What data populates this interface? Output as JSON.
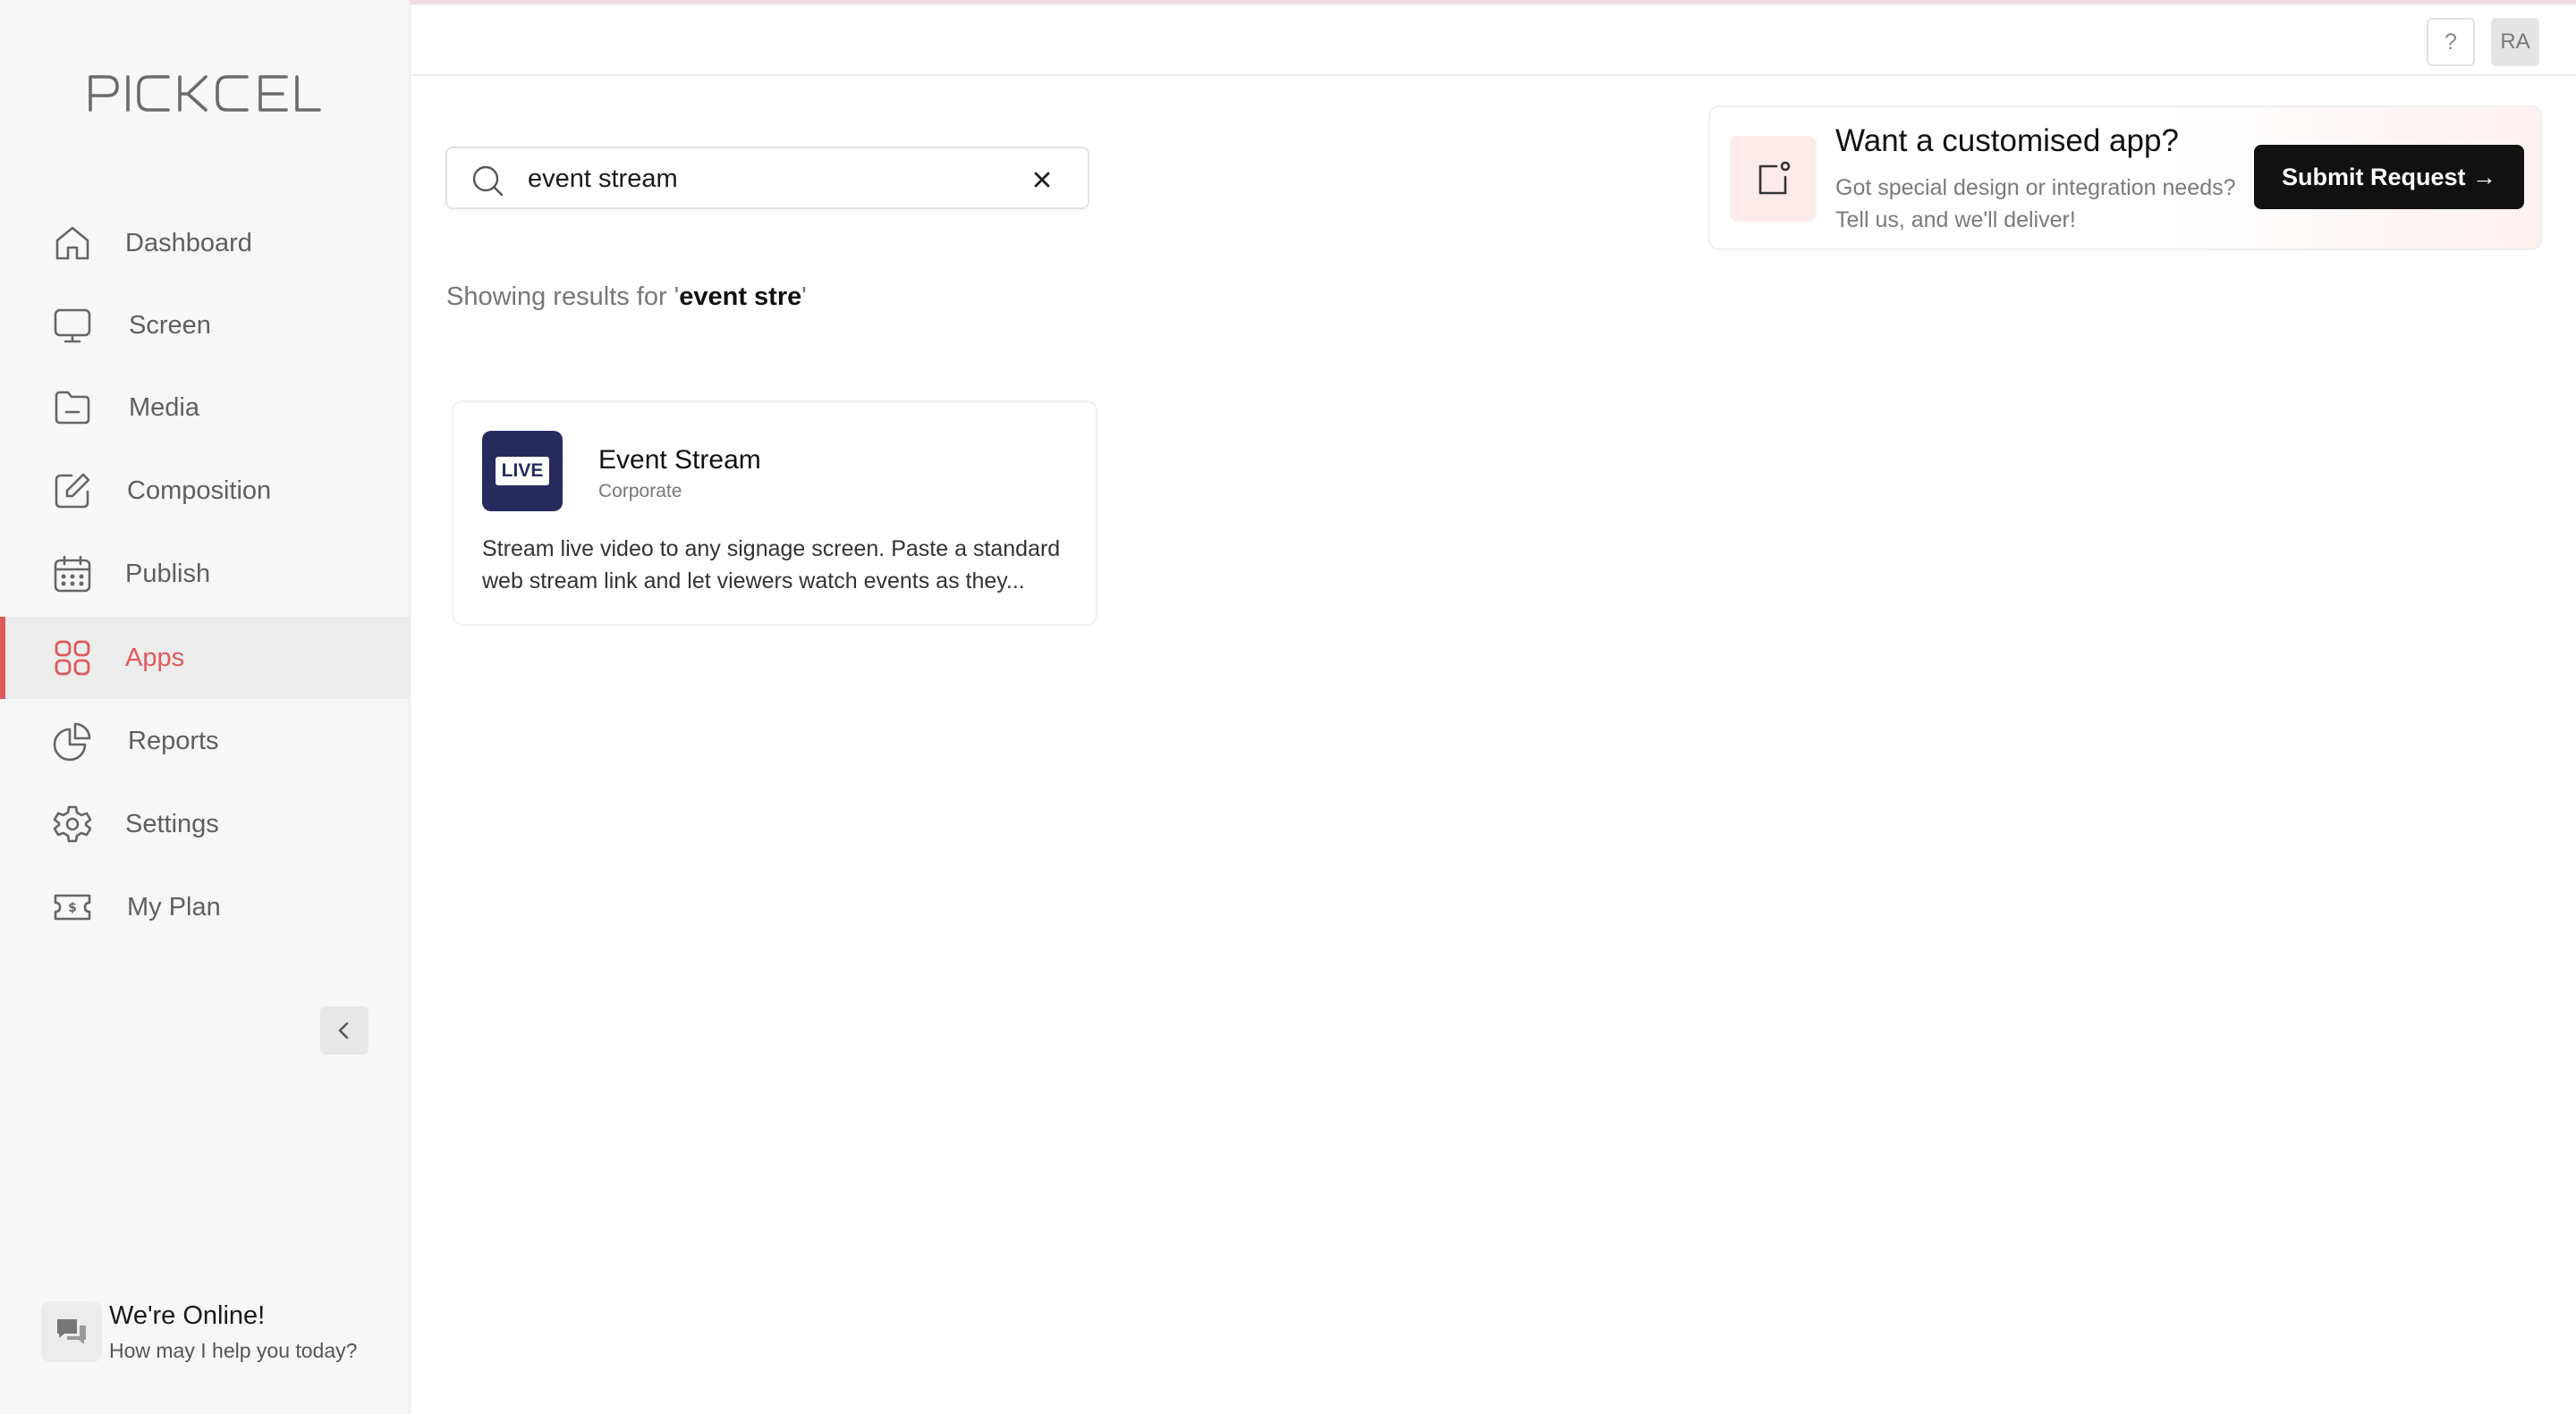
{
  "brand": {
    "logo_text": "PICKCEL"
  },
  "sidebar": {
    "items": [
      {
        "label": "Dashboard",
        "icon": "home-icon"
      },
      {
        "label": "Screen",
        "icon": "monitor-icon"
      },
      {
        "label": "Media",
        "icon": "folder-icon"
      },
      {
        "label": "Composition",
        "icon": "edit-icon"
      },
      {
        "label": "Publish",
        "icon": "calendar-icon"
      },
      {
        "label": "Apps",
        "icon": "grid-icon",
        "active": true
      },
      {
        "label": "Reports",
        "icon": "pie-chart-icon"
      },
      {
        "label": "Settings",
        "icon": "gear-icon"
      },
      {
        "label": "My Plan",
        "icon": "ticket-dollar-icon"
      }
    ],
    "collapse_icon": "chevron-left-icon"
  },
  "chat": {
    "title": "We're Online!",
    "subtitle": "How may I help you today?",
    "icon": "chat-icon"
  },
  "topbar": {
    "help_label": "?",
    "avatar_initials": "RA"
  },
  "search": {
    "value": "event stream",
    "placeholder": ""
  },
  "results": {
    "prefix": "Showing results for '",
    "query": "event stre",
    "suffix": "'"
  },
  "promo": {
    "title": "Want a customised app?",
    "description": "Got special design or integration needs? Tell us, and we'll deliver!",
    "button_label": "Submit Request →"
  },
  "app_card": {
    "name": "Event Stream",
    "category": "Corporate",
    "badge": "LIVE",
    "description": "Stream live video to any signage screen. Paste a standard web stream link and let viewers watch events as they..."
  },
  "colors": {
    "accent": "#e0595b",
    "sidebar_bg": "#f7f7f7",
    "app_logo_bg": "#262b5e",
    "button_bg": "#111111"
  }
}
